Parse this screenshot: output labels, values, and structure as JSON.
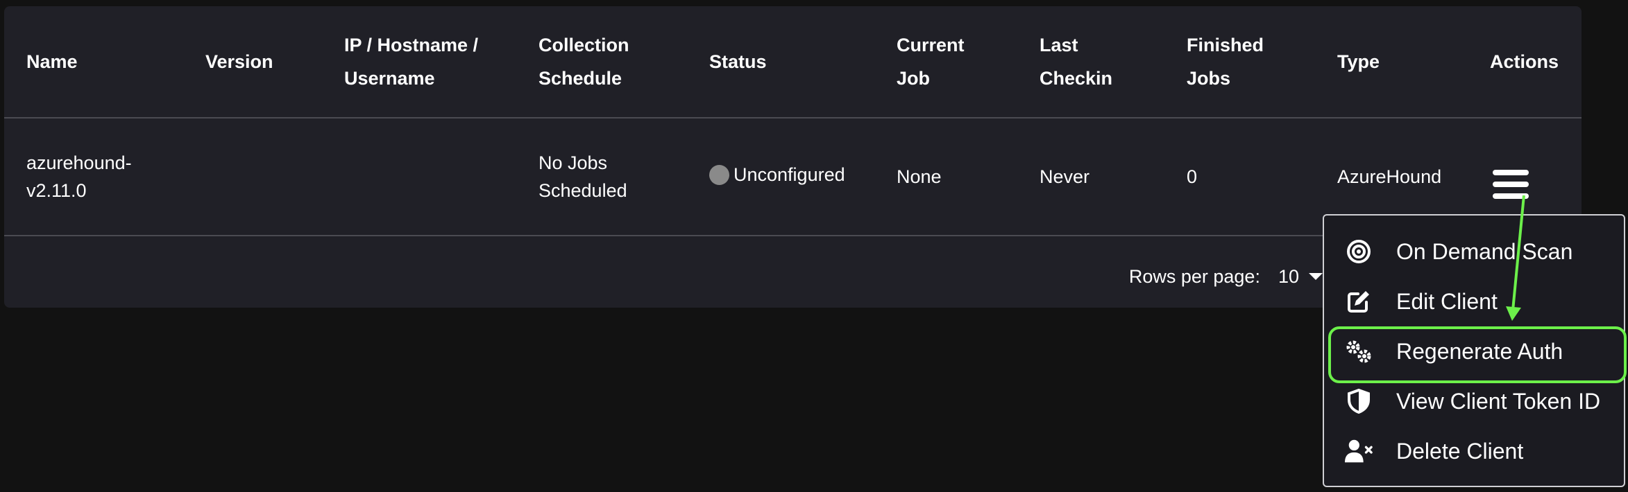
{
  "table": {
    "headers": {
      "name": "Name",
      "version": "Version",
      "ip_line1": "IP / Hostname /",
      "ip_line2": "Username",
      "schedule_line1": "Collection",
      "schedule_line2": "Schedule",
      "status": "Status",
      "current_job_line1": "Current",
      "current_job_line2": "Job",
      "last_checkin_line1": "Last",
      "last_checkin_line2": "Checkin",
      "finished_jobs_line1": "Finished",
      "finished_jobs_line2": "Jobs",
      "type": "Type",
      "actions": "Actions"
    },
    "rows": [
      {
        "name_line1": "azurehound-",
        "name_line2": "v2.11.0",
        "version": "",
        "ip": "",
        "schedule_line1": "No Jobs",
        "schedule_line2": "Scheduled",
        "status": "Unconfigured",
        "current_job": "None",
        "last_checkin": "Never",
        "finished_jobs": "0",
        "type": "AzureHound"
      }
    ]
  },
  "pagination": {
    "rows_per_page_label": "Rows per page:",
    "rows_per_page_value": "10"
  },
  "actions_menu": {
    "items": [
      {
        "label": "On Demand Scan",
        "icon": "bullseye-icon"
      },
      {
        "label": "Edit Client",
        "icon": "edit-icon"
      },
      {
        "label": "Regenerate Auth",
        "icon": "gears-icon"
      },
      {
        "label": "View Client Token ID",
        "icon": "shield-icon"
      },
      {
        "label": "Delete Client",
        "icon": "user-delete-icon"
      }
    ],
    "highlighted_item": "Regenerate Auth"
  },
  "colors": {
    "background": "#121212",
    "card": "#202027",
    "menu_border": "#d0d0d4",
    "highlight": "#6cf04a",
    "status_dot": "#8a8a8a"
  }
}
